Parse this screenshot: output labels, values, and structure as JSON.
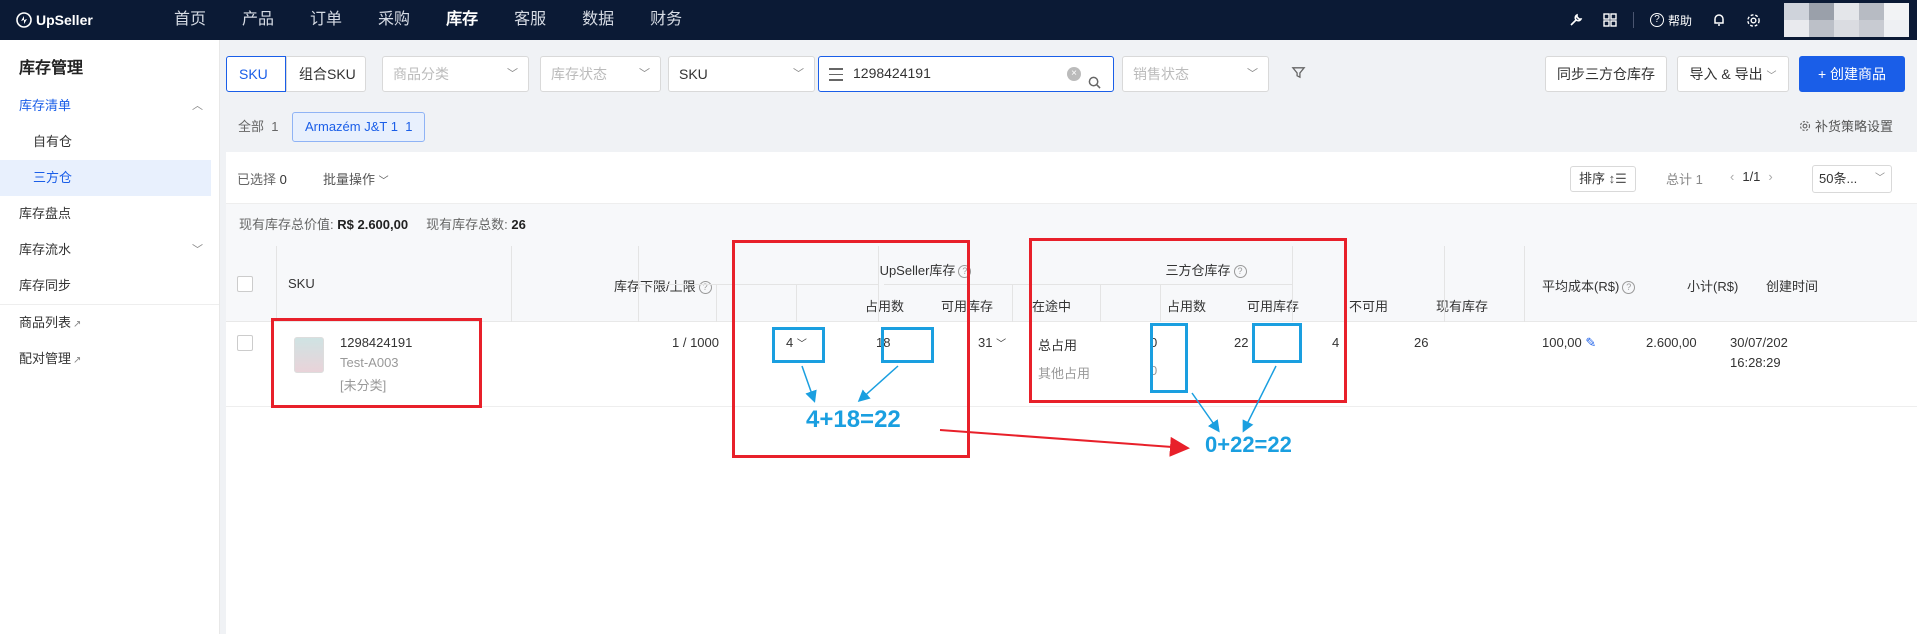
{
  "brand": "UpSeller",
  "nav": [
    "首页",
    "产品",
    "订单",
    "采购",
    "库存",
    "客服",
    "数据",
    "财务"
  ],
  "nav_active": "库存",
  "nav_right": {
    "help": "帮助"
  },
  "sidebar": {
    "title": "库存管理",
    "group": "库存清单",
    "sub_own": "自有仓",
    "sub_third": "三方仓",
    "item_count": "库存盘点",
    "item_flow": "库存流水",
    "item_sync": "库存同步",
    "item_products": "商品列表",
    "item_pairing": "配对管理"
  },
  "toolbar": {
    "seg_sku": "SKU",
    "seg_combo": "组合SKU",
    "category_placeholder": "商品分类",
    "stock_status_placeholder": "库存状态",
    "search_field": "SKU",
    "search_value": "1298424191",
    "sales_status_placeholder": "销售状态",
    "sync_btn": "同步三方仓库存",
    "import_export_btn": "导入 & 导出",
    "create_btn": "+ 创建商品"
  },
  "tabs": {
    "all_label": "全部",
    "all_count": "1",
    "warehouse_label": "Armazém J&T 1",
    "warehouse_count": "1"
  },
  "replenish": "补货策略设置",
  "list": {
    "selected_label": "已选择",
    "selected_count": "0",
    "bulk": "批量操作",
    "sort": "排序",
    "total": "总计 1",
    "page": "1/1",
    "page_size": "50条..."
  },
  "summary": {
    "value_label": "现有库存总价值:",
    "value": "R$ 2.600,00",
    "qty_label": "现有库存总数:",
    "qty": "26"
  },
  "headers": {
    "sku": "SKU",
    "limits": "库存下限/上限",
    "upseller": "UpSeller库存",
    "occupied": "占用数",
    "available": "可用库存",
    "in_transit": "在途中",
    "third_party": "三方仓库存",
    "tp_occupied": "占用数",
    "tp_available": "可用库存",
    "unavailable": "不可用",
    "current": "现有库存",
    "avg_cost": "平均成本(R$)",
    "subtotal": "小计(R$)",
    "created": "创建时间"
  },
  "row": {
    "sku": "1298424191",
    "code": "Test-A003",
    "category": "[未分类]",
    "limits": "1 / 1000",
    "occupied": "4",
    "available": "18",
    "in_transit": "31",
    "tp_total_label": "总占用",
    "tp_total": "0",
    "tp_other_label": "其他占用",
    "tp_other": "0",
    "tp_available": "22",
    "unavailable": "4",
    "current": "26",
    "avg_cost": "100,00",
    "subtotal": "2.600,00",
    "created_date": "30/07/202",
    "created_time": "16:28:29"
  },
  "annotations": {
    "eq1": "4+18=22",
    "eq2": "0+22=22"
  }
}
